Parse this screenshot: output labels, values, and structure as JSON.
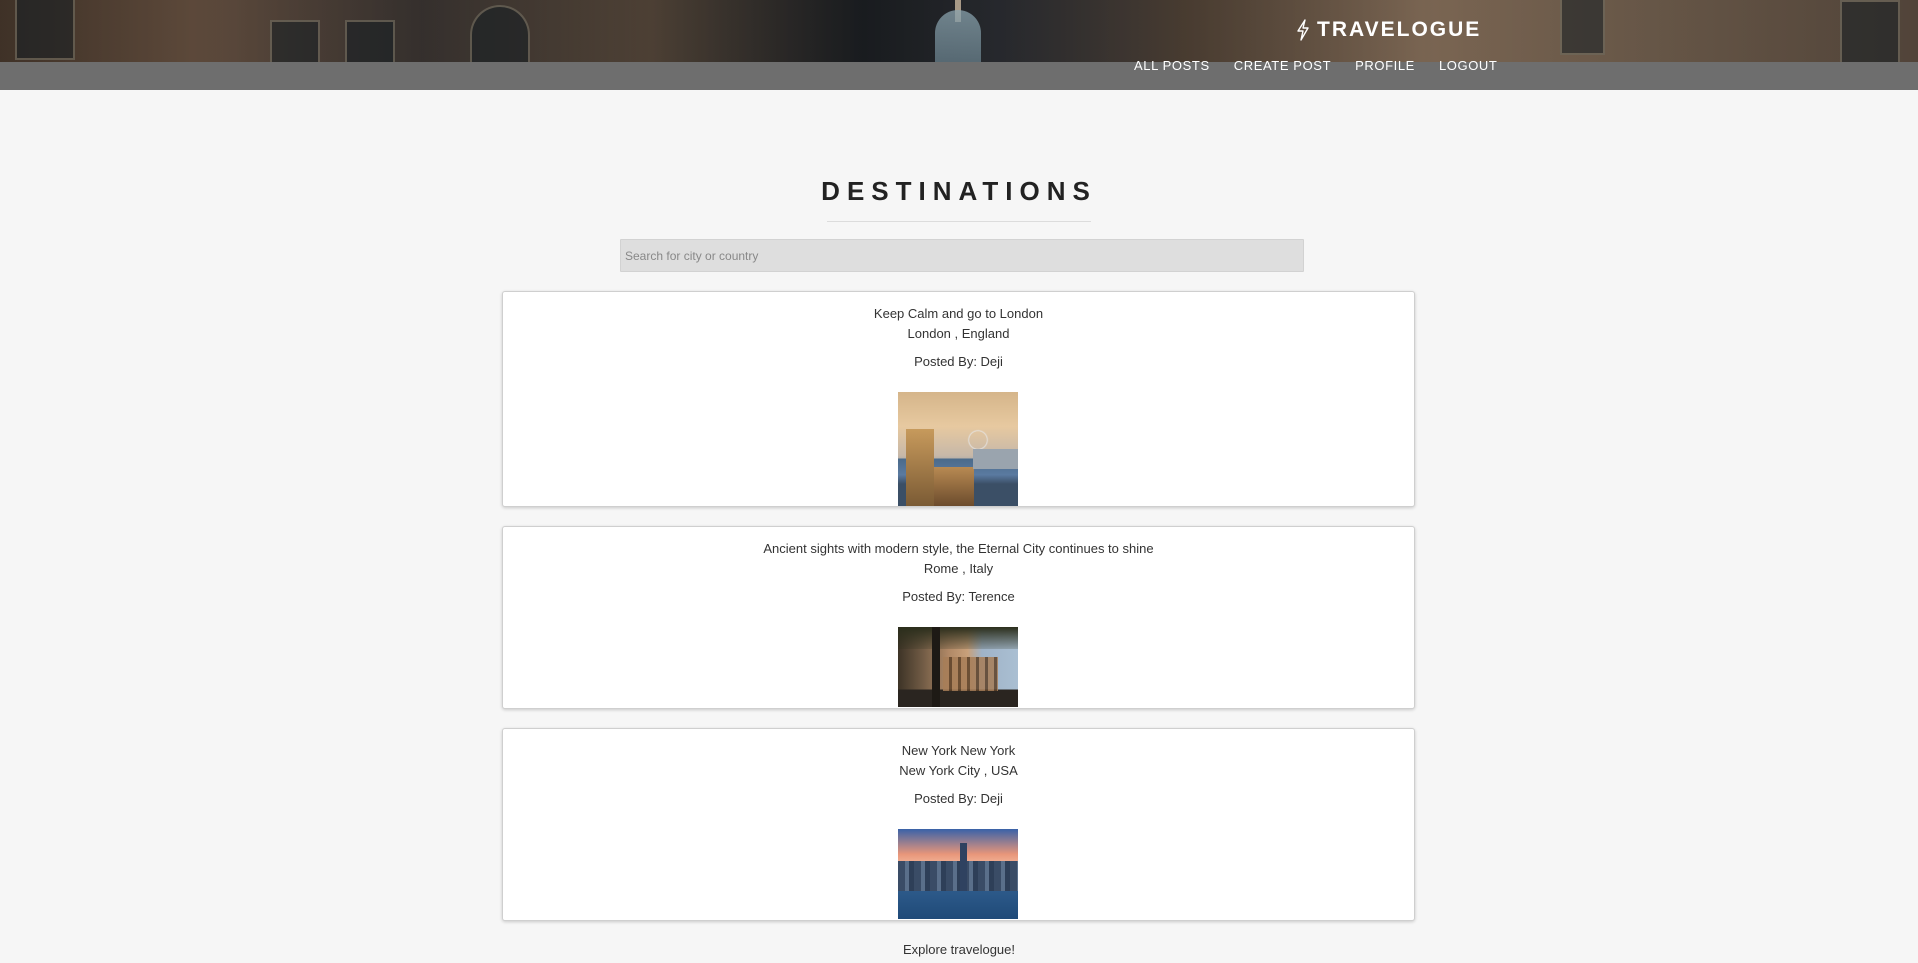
{
  "brand": {
    "name": "TRAVELOGUE",
    "icon": "lightning-bolt-icon"
  },
  "nav": [
    {
      "label": "ALL POSTS"
    },
    {
      "label": "CREATE POST"
    },
    {
      "label": "PROFILE"
    },
    {
      "label": "LOGOUT"
    }
  ],
  "page": {
    "title": "DESTINATIONS",
    "search_placeholder": "Search for city or country"
  },
  "posts": [
    {
      "title": "Keep Calm and go to London",
      "location": "London , England",
      "posted_by": "Posted By: Deji",
      "image": "london-cityscape-photo"
    },
    {
      "title": "Ancient sights with modern style, the Eternal City continues to shine",
      "location": "Rome , Italy",
      "posted_by": "Posted By: Terence",
      "image": "rome-colosseum-photo"
    },
    {
      "title": "New York New York",
      "location": "New York City , USA",
      "posted_by": "Posted By: Deji",
      "image": "new-york-skyline-photo"
    }
  ],
  "footer": {
    "text": "Explore travelogue!"
  },
  "colors": {
    "page_background": "#f6f6f6",
    "card_background": "#ffffff",
    "search_background": "#dedede",
    "header_text": "#ffffff",
    "title_text": "#222222"
  }
}
